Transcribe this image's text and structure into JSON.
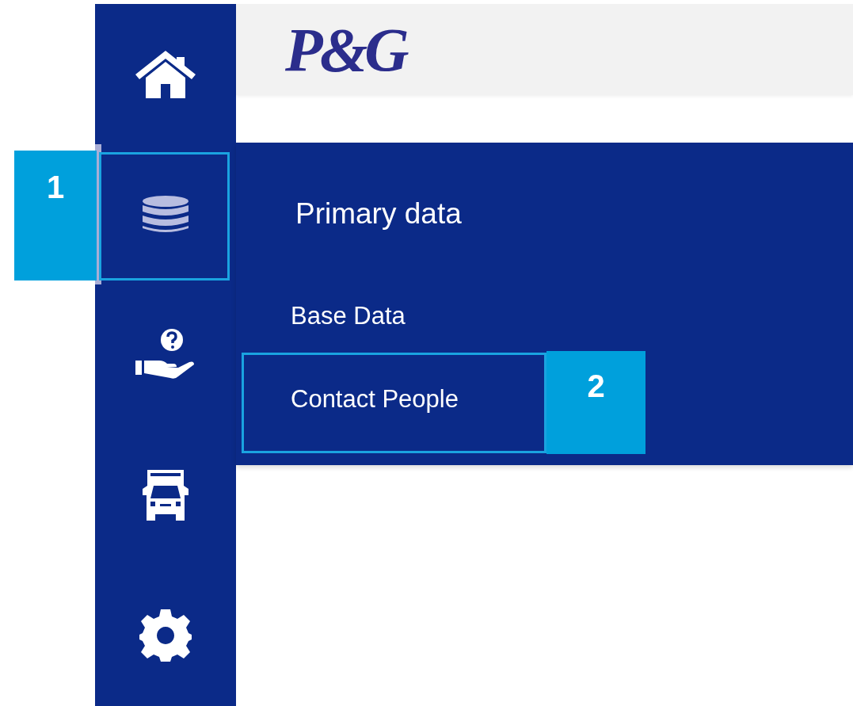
{
  "logo": "P&G",
  "sidebar": {
    "items": [
      {
        "kind": "home",
        "selected": false
      },
      {
        "kind": "database",
        "selected": true,
        "callout": "1"
      },
      {
        "kind": "hand",
        "selected": false
      },
      {
        "kind": "truck",
        "selected": false
      },
      {
        "kind": "gear",
        "selected": false
      }
    ]
  },
  "flyout": {
    "title": "Primary data",
    "items": [
      {
        "label": "Base Data"
      },
      {
        "label": "Contact People",
        "callout": "2"
      }
    ]
  }
}
